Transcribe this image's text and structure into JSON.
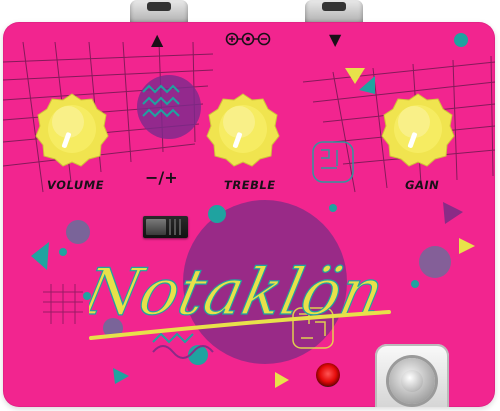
{
  "brand": {
    "name": "Notaklön",
    "accent_color": "#f2258f",
    "script_color": "#e8e14a"
  },
  "controls": {
    "volume": {
      "label": "VOLUME",
      "color": "#f5ec5a"
    },
    "treble": {
      "label": "TREBLE",
      "color": "#f5ec5a"
    },
    "gain": {
      "label": "GAIN",
      "color": "#f5ec5a"
    }
  },
  "toggle": {
    "label": "−/+"
  },
  "io": {
    "input_icon": "triangle-up-icon",
    "output_icon": "triangle-down-icon",
    "power_icon": "dc-power-polarity-icon"
  },
  "led": {
    "color": "#e40a0a"
  },
  "footswitch": {
    "icon": "footswitch-icon"
  }
}
